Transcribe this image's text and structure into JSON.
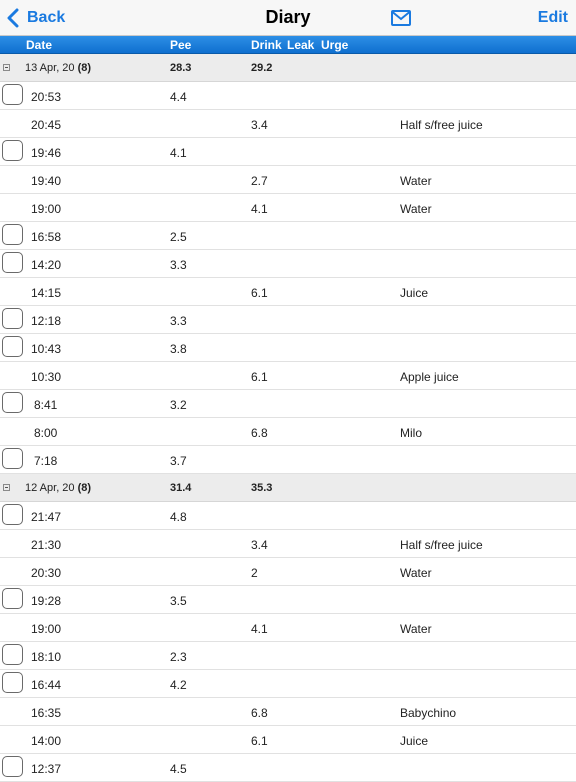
{
  "nav": {
    "back_label": "Back",
    "title": "Diary",
    "edit_label": "Edit"
  },
  "columns": [
    "Date",
    "Pee",
    "Drink",
    "Leak",
    "Urge"
  ],
  "colors": {
    "accent": "#1a7ae0",
    "header_bar": "#1877d6"
  },
  "rows": [
    {
      "type": "group",
      "date": "13 Apr, 20",
      "count": "(8)",
      "pee": "28.3",
      "drink": "29.2"
    },
    {
      "type": "entry",
      "check": true,
      "time": "20:53",
      "pee": "4.4",
      "drink": "",
      "note": ""
    },
    {
      "type": "entry",
      "check": false,
      "time": "20:45",
      "pee": "",
      "drink": "3.4",
      "note": "Half s/free juice"
    },
    {
      "type": "entry",
      "check": true,
      "time": "19:46",
      "pee": "4.1",
      "drink": "",
      "note": ""
    },
    {
      "type": "entry",
      "check": false,
      "time": "19:40",
      "pee": "",
      "drink": "2.7",
      "note": "Water"
    },
    {
      "type": "entry",
      "check": false,
      "time": "19:00",
      "pee": "",
      "drink": "4.1",
      "note": "Water"
    },
    {
      "type": "entry",
      "check": true,
      "time": "16:58",
      "pee": "2.5",
      "drink": "",
      "note": ""
    },
    {
      "type": "entry",
      "check": true,
      "time": "14:20",
      "pee": "3.3",
      "drink": "",
      "note": ""
    },
    {
      "type": "entry",
      "check": false,
      "time": "14:15",
      "pee": "",
      "drink": "6.1",
      "note": "Juice"
    },
    {
      "type": "entry",
      "check": true,
      "time": "12:18",
      "pee": "3.3",
      "drink": "",
      "note": ""
    },
    {
      "type": "entry",
      "check": true,
      "time": "10:43",
      "pee": "3.8",
      "drink": "",
      "note": ""
    },
    {
      "type": "entry",
      "check": false,
      "time": "10:30",
      "pee": "",
      "drink": "6.1",
      "note": "Apple juice"
    },
    {
      "type": "entry",
      "check": true,
      "time": "8:41",
      "pee": "3.2",
      "drink": "",
      "note": ""
    },
    {
      "type": "entry",
      "check": false,
      "time": "8:00",
      "pee": "",
      "drink": "6.8",
      "note": "Milo"
    },
    {
      "type": "entry",
      "check": true,
      "time": "7:18",
      "pee": "3.7",
      "drink": "",
      "note": ""
    },
    {
      "type": "group",
      "date": "12 Apr, 20",
      "count": "(8)",
      "pee": "31.4",
      "drink": "35.3"
    },
    {
      "type": "entry",
      "check": true,
      "time": "21:47",
      "pee": "4.8",
      "drink": "",
      "note": ""
    },
    {
      "type": "entry",
      "check": false,
      "time": "21:30",
      "pee": "",
      "drink": "3.4",
      "note": "Half s/free juice"
    },
    {
      "type": "entry",
      "check": false,
      "time": "20:30",
      "pee": "",
      "drink": "2",
      "note": "Water"
    },
    {
      "type": "entry",
      "check": true,
      "time": "19:28",
      "pee": "3.5",
      "drink": "",
      "note": ""
    },
    {
      "type": "entry",
      "check": false,
      "time": "19:00",
      "pee": "",
      "drink": "4.1",
      "note": "Water"
    },
    {
      "type": "entry",
      "check": true,
      "time": "18:10",
      "pee": "2.3",
      "drink": "",
      "note": ""
    },
    {
      "type": "entry",
      "check": true,
      "time": "16:44",
      "pee": "4.2",
      "drink": "",
      "note": ""
    },
    {
      "type": "entry",
      "check": false,
      "time": "16:35",
      "pee": "",
      "drink": "6.8",
      "note": "Babychino"
    },
    {
      "type": "entry",
      "check": false,
      "time": "14:00",
      "pee": "",
      "drink": "6.1",
      "note": "Juice"
    },
    {
      "type": "entry",
      "check": true,
      "time": "12:37",
      "pee": "4.5",
      "drink": "",
      "note": ""
    }
  ]
}
